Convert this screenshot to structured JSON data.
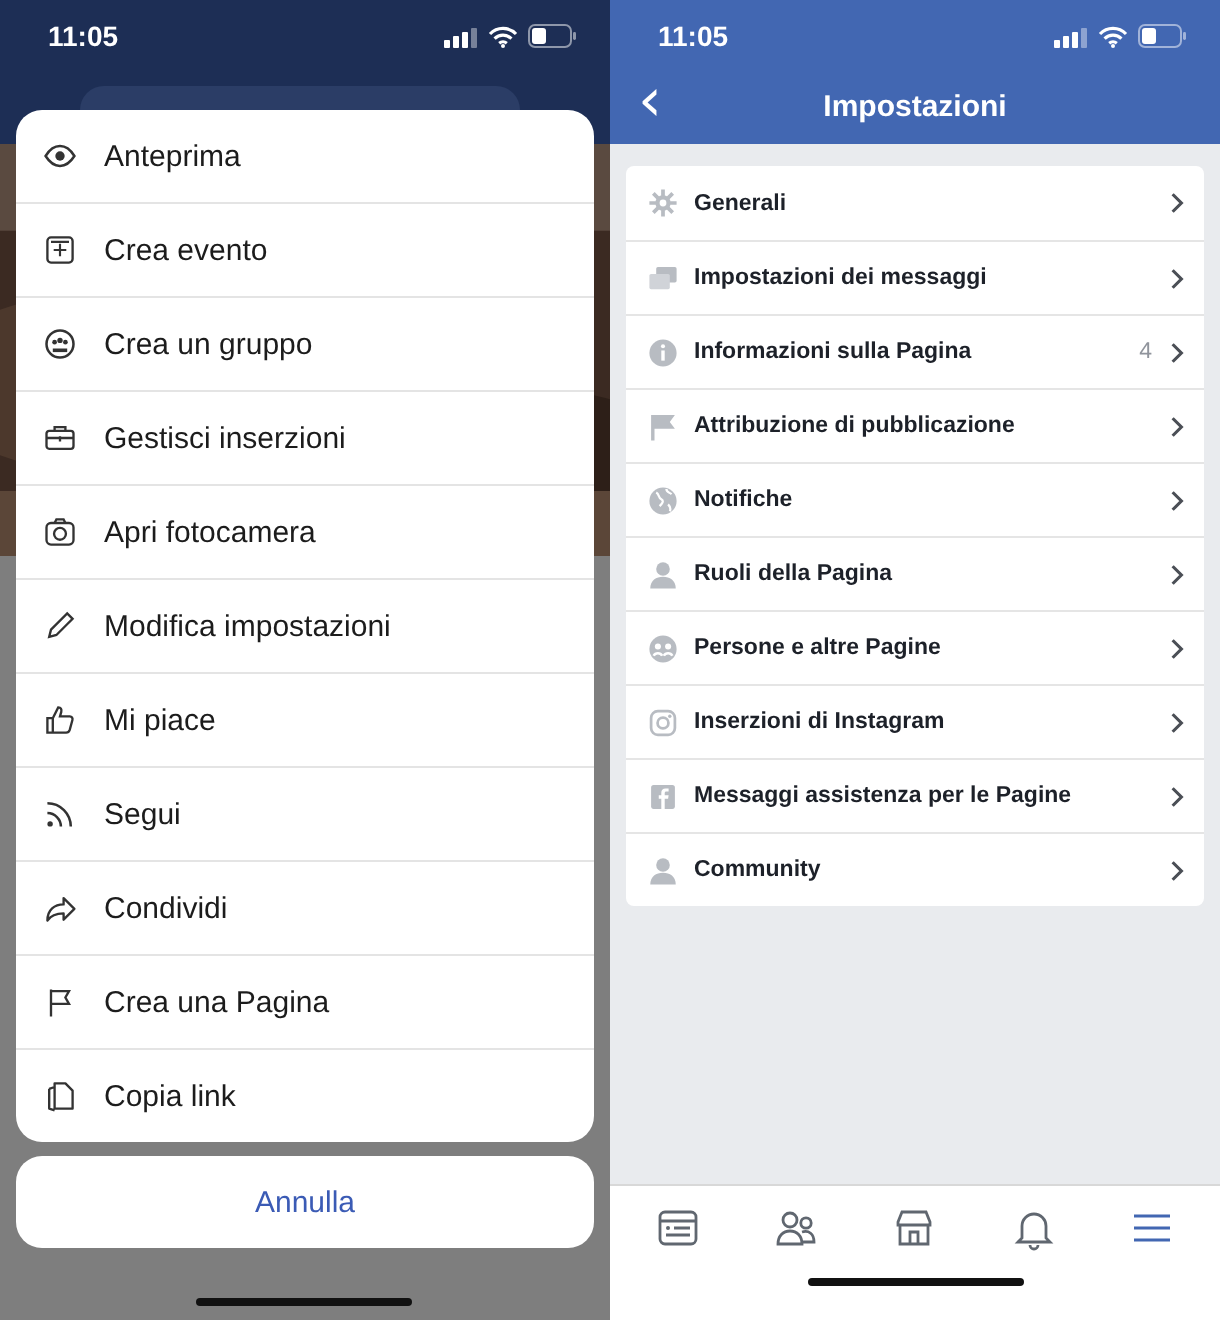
{
  "left": {
    "status_bar": {
      "time": "11:05"
    },
    "action_sheet": {
      "items": [
        {
          "label": "Anteprima"
        },
        {
          "label": "Crea evento"
        },
        {
          "label": "Crea un gruppo"
        },
        {
          "label": "Gestisci inserzioni"
        },
        {
          "label": "Apri fotocamera"
        },
        {
          "label": "Modifica impostazioni"
        },
        {
          "label": "Mi piace"
        },
        {
          "label": "Segui"
        },
        {
          "label": "Condividi"
        },
        {
          "label": "Crea una Pagina"
        },
        {
          "label": "Copia link"
        }
      ]
    },
    "cancel_button": "Annulla"
  },
  "right": {
    "status_bar": {
      "time": "11:05"
    },
    "header": {
      "title": "Impostazioni",
      "back": "‹"
    },
    "settings": [
      {
        "label": "Generali"
      },
      {
        "label": "Impostazioni dei messaggi"
      },
      {
        "label": "Informazioni sulla Pagina",
        "badge": "4"
      },
      {
        "label": "Attribuzione di pubblicazione"
      },
      {
        "label": "Notifiche"
      },
      {
        "label": "Ruoli della Pagina"
      },
      {
        "label": "Persone e altre Pagine"
      },
      {
        "label": "Inserzioni di Instagram"
      },
      {
        "label": "Messaggi assistenza per le Pagine"
      },
      {
        "label": "Community"
      }
    ],
    "tab_bar": [
      {
        "selected": false
      },
      {
        "selected": false
      },
      {
        "selected": false
      },
      {
        "selected": false
      },
      {
        "selected": true
      }
    ]
  }
}
